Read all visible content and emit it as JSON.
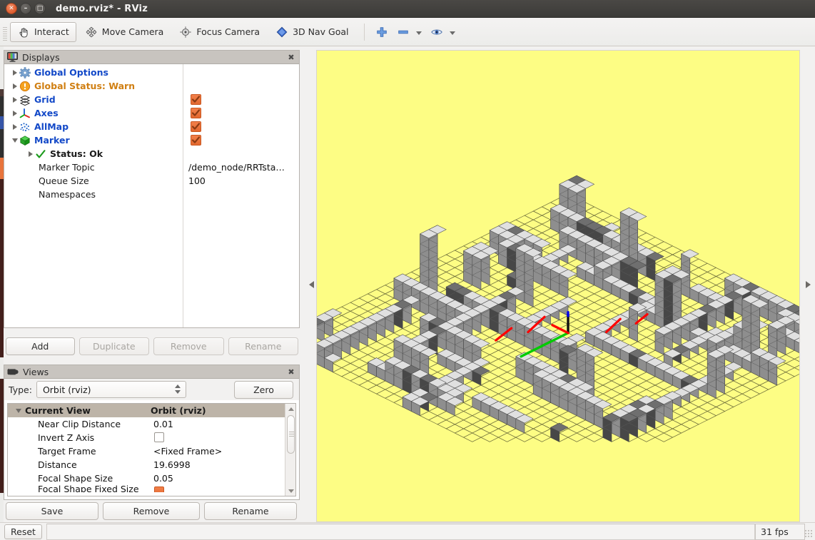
{
  "window": {
    "title": "demo.rviz* - RViz",
    "controls": {
      "close": "close-button",
      "minimize": "minimize-button",
      "maximize": "maximize-button"
    }
  },
  "toolbar": {
    "buttons": [
      {
        "label": "Interact",
        "icon": "hand-cursor-icon",
        "active": true
      },
      {
        "label": "Move Camera",
        "icon": "move-camera-icon",
        "active": false
      },
      {
        "label": "Focus Camera",
        "icon": "focus-camera-icon",
        "active": false
      },
      {
        "label": "3D Nav Goal",
        "icon": "nav-goal-diamond-icon",
        "active": false
      }
    ],
    "tools": [
      {
        "icon": "plus-icon",
        "has_dropdown": false
      },
      {
        "icon": "minus-icon",
        "has_dropdown": true
      },
      {
        "icon": "eye-icon",
        "has_dropdown": true
      }
    ]
  },
  "displays_panel": {
    "title": "Displays",
    "icon": "monitor-icon",
    "close_label": "✖",
    "rows": [
      {
        "label": "Global Options",
        "icon": "gear-icon",
        "style": "blue",
        "arrow": "collapsed",
        "indent": 0,
        "checkbox": null,
        "value": null
      },
      {
        "label": "Global Status: Warn",
        "icon": "warning-icon",
        "style": "warn",
        "arrow": "collapsed",
        "indent": 0,
        "checkbox": null,
        "value": null
      },
      {
        "label": "Grid",
        "icon": "grid-icon",
        "style": "blue",
        "arrow": "collapsed",
        "indent": 0,
        "checkbox": true,
        "value": null
      },
      {
        "label": "Axes",
        "icon": "axes-icon",
        "style": "blue",
        "arrow": "collapsed",
        "indent": 0,
        "checkbox": true,
        "value": null
      },
      {
        "label": "AllMap",
        "icon": "pointcloud-icon",
        "style": "blue",
        "arrow": "collapsed",
        "indent": 0,
        "checkbox": true,
        "value": null
      },
      {
        "label": "Marker",
        "icon": "marker-cube-icon",
        "style": "blue",
        "arrow": "expanded",
        "indent": 0,
        "checkbox": true,
        "value": null
      },
      {
        "label": "Status: Ok",
        "icon": "check-icon",
        "style": "bold",
        "arrow": "collapsed",
        "indent": 1,
        "checkbox": null,
        "value": null
      },
      {
        "label": "Marker Topic",
        "icon": null,
        "style": "plain",
        "arrow": null,
        "indent": 1,
        "checkbox": null,
        "value": "/demo_node/RRTsta…"
      },
      {
        "label": "Queue Size",
        "icon": null,
        "style": "plain",
        "arrow": null,
        "indent": 1,
        "checkbox": null,
        "value": "100"
      },
      {
        "label": "Namespaces",
        "icon": null,
        "style": "plain",
        "arrow": null,
        "indent": 1,
        "checkbox": null,
        "value": null
      }
    ]
  },
  "displays_buttons": [
    {
      "label": "Add",
      "enabled": true
    },
    {
      "label": "Duplicate",
      "enabled": false
    },
    {
      "label": "Remove",
      "enabled": false
    },
    {
      "label": "Rename",
      "enabled": false
    }
  ],
  "views_panel": {
    "title": "Views",
    "icon": "camera-icon",
    "close_label": "✖",
    "type_label": "Type:",
    "type_value": "Orbit (rviz)",
    "zero_button": "Zero",
    "header": {
      "col1": "Current View",
      "col2": "Orbit (rviz)"
    },
    "properties": [
      {
        "key": "Near Clip Distance",
        "value": "0.01",
        "widget": "text"
      },
      {
        "key": "Invert Z Axis",
        "value": "",
        "widget": "checkbox-off"
      },
      {
        "key": "Target Frame",
        "value": "<Fixed Frame>",
        "widget": "text"
      },
      {
        "key": "Distance",
        "value": "19.6998",
        "widget": "text"
      },
      {
        "key": "Focal Shape Size",
        "value": "0.05",
        "widget": "text"
      },
      {
        "key": "Focal Shape Fixed Size",
        "value": "",
        "widget": "checkbox-on"
      }
    ]
  },
  "views_buttons": [
    {
      "label": "Save",
      "enabled": true
    },
    {
      "label": "Remove",
      "enabled": true
    },
    {
      "label": "Rename",
      "enabled": true
    }
  ],
  "statusbar": {
    "reset_label": "Reset",
    "message": "",
    "fps": "31 fps"
  },
  "viewport": {
    "background_color": "#fdfd84",
    "grid_line_color": "#6b6b3a",
    "voxel_light": "#e0e0e0",
    "voxel_dark": "#7a7a7a",
    "axis_x_color": "#ff0000",
    "axis_y_color": "#00cc00",
    "axis_z_color": "#0000ee",
    "left_collapse_icon": "chevron-left-icon",
    "right_collapse_icon": "chevron-right-icon"
  }
}
